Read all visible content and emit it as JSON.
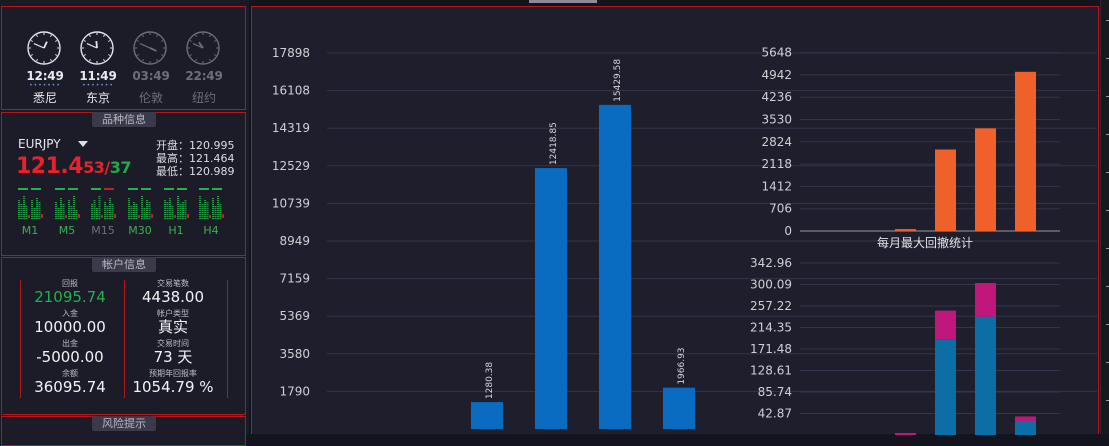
{
  "clocks": [
    {
      "time": "12:49",
      "city": "悉尼",
      "active": true
    },
    {
      "time": "11:49",
      "city": "东京",
      "active": true
    },
    {
      "time": "03:49",
      "city": "伦敦",
      "active": false
    },
    {
      "time": "22:49",
      "city": "纽约",
      "active": false
    }
  ],
  "symbol_panel": {
    "title": "品种信息",
    "symbol": "EURJPY",
    "price_main": "121.4",
    "price_part1": "53",
    "price_sep": "/",
    "price_part2": "37",
    "open": "开盘：120.995",
    "high": "最高：121.464",
    "low": "最低：120.989",
    "timeframes": [
      "M1",
      "M5",
      "M15",
      "M30",
      "H1",
      "H4"
    ]
  },
  "account_panel": {
    "title": "帐户信息",
    "items": [
      {
        "label": "回报",
        "value": "21095.74",
        "color": "#22b14c"
      },
      {
        "label": "交易笔数",
        "value": "4438.00"
      },
      {
        "label": "入金",
        "value": "10000.00"
      },
      {
        "label": "帐户类型",
        "value": "真实"
      },
      {
        "label": "出金",
        "value": "-5000.00"
      },
      {
        "label": "交易时间",
        "value": "73 天"
      },
      {
        "label": "余额",
        "value": "36095.74"
      },
      {
        "label": "预期年回报率",
        "value": "1054.79 %"
      }
    ]
  },
  "risk_panel": {
    "title": "风险提示"
  },
  "chart_data": [
    {
      "type": "bar",
      "title": "",
      "y_ticks": [
        "17898",
        "16108",
        "14319",
        "12529",
        "10739",
        "8949",
        "7159",
        "5369",
        "3580",
        "1790"
      ],
      "ylim": [
        0,
        17898
      ],
      "values": [
        1280.38,
        12418.85,
        15429.58,
        1966.93
      ],
      "data_labels": [
        "1280.38",
        "12418.85",
        "15429.58",
        "1966.93"
      ],
      "color": "#0a6cc0"
    },
    {
      "type": "bar",
      "title": "每月最大回撤统计",
      "y_ticks": [
        "5648",
        "4942",
        "4236",
        "3530",
        "2824",
        "2118",
        "1412",
        "706",
        "0"
      ],
      "ylim": [
        0,
        5648
      ],
      "values": [
        60,
        2580,
        3250,
        5040
      ],
      "color": "#f0602a"
    },
    {
      "type": "bar",
      "title": "",
      "y_ticks": [
        "342.96",
        "300.09",
        "257.22",
        "214.35",
        "171.48",
        "128.61",
        "85.74",
        "42.87"
      ],
      "ylim": [
        0,
        342.96
      ],
      "series": [
        {
          "values": [
            0,
            190,
            236,
            28
          ],
          "color": "#0b6fa6"
        },
        {
          "values": [
            4,
            58,
            67,
            9
          ],
          "color": "#c0187a"
        }
      ]
    }
  ]
}
